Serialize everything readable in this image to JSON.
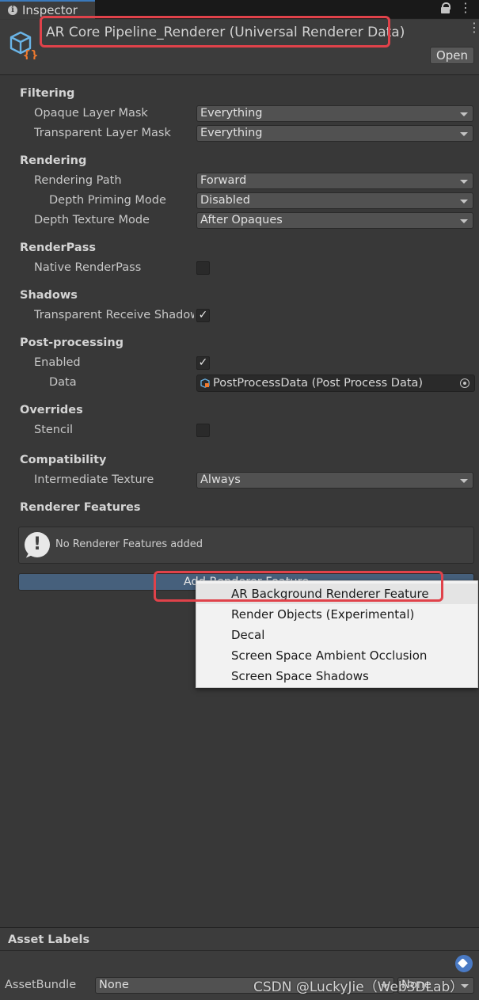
{
  "tab": {
    "label": "Inspector"
  },
  "header": {
    "title": "AR Core Pipeline_Renderer (Universal Renderer Data)",
    "open_label": "Open"
  },
  "filtering": {
    "title": "Filtering",
    "opaque_label": "Opaque Layer Mask",
    "opaque_value": "Everything",
    "transparent_label": "Transparent Layer Mask",
    "transparent_value": "Everything"
  },
  "rendering": {
    "title": "Rendering",
    "path_label": "Rendering Path",
    "path_value": "Forward",
    "depth_priming_label": "Depth Priming Mode",
    "depth_priming_value": "Disabled",
    "depth_texture_label": "Depth Texture Mode",
    "depth_texture_value": "After Opaques"
  },
  "renderpass": {
    "title": "RenderPass",
    "native_label": "Native RenderPass",
    "native_checked": false
  },
  "shadows": {
    "title": "Shadows",
    "transparent_label": "Transparent Receive Shadows",
    "transparent_checked": true
  },
  "postprocessing": {
    "title": "Post-processing",
    "enabled_label": "Enabled",
    "enabled_checked": true,
    "data_label": "Data",
    "data_value": "PostProcessData (Post Process Data)"
  },
  "overrides": {
    "title": "Overrides",
    "stencil_label": "Stencil",
    "stencil_checked": false
  },
  "compatibility": {
    "title": "Compatibility",
    "intermediate_label": "Intermediate Texture",
    "intermediate_value": "Always"
  },
  "features": {
    "title": "Renderer Features",
    "empty_message": "No Renderer Features added",
    "add_label": "Add Renderer Feature"
  },
  "popup_menu": {
    "items": [
      {
        "label": "AR Background Renderer Feature"
      },
      {
        "label": "Render Objects (Experimental)"
      },
      {
        "label": "Decal"
      },
      {
        "label": "Screen Space Ambient Occlusion"
      },
      {
        "label": "Screen Space Shadows"
      }
    ]
  },
  "asset_labels": {
    "title": "Asset Labels",
    "bundle_label": "AssetBundle",
    "bundle_value": "None",
    "variant_value": "None"
  },
  "watermark": "CSDN @LuckyJie（Web3DLab）",
  "colors": {
    "highlight": "#e0424a",
    "accent_button": "#46607c",
    "tag_icon": "#4a7ac4"
  }
}
